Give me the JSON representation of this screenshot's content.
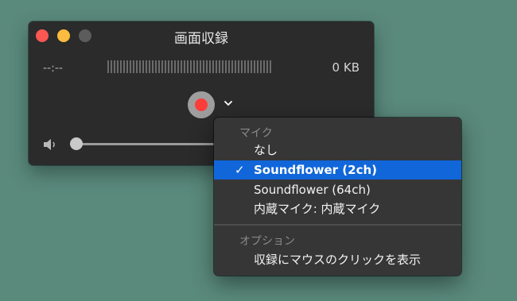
{
  "window": {
    "title": "画面収録",
    "time_display": "--:--",
    "file_size": "0 KB"
  },
  "controls": {
    "record_button": "record-button",
    "options_chevron": "chevron-down-icon",
    "volume_icon": "speaker-icon",
    "volume_level": 0
  },
  "menu": {
    "microphone_header": "マイク",
    "items": [
      {
        "label": "なし",
        "checked": false
      },
      {
        "label": "Soundflower (2ch)",
        "checked": true
      },
      {
        "label": "Soundflower (64ch)",
        "checked": false
      },
      {
        "label": "内蔵マイク: 内蔵マイク",
        "checked": false
      }
    ],
    "check_mark": "✓",
    "options_header": "オプション",
    "options_items": [
      {
        "label": "収録にマウスのクリックを表示"
      }
    ]
  },
  "colors": {
    "desktop": "#5a8a7c",
    "window_bg": "#2b2b2b",
    "record_red": "#fc3d39",
    "selection_blue": "#1167d9"
  }
}
